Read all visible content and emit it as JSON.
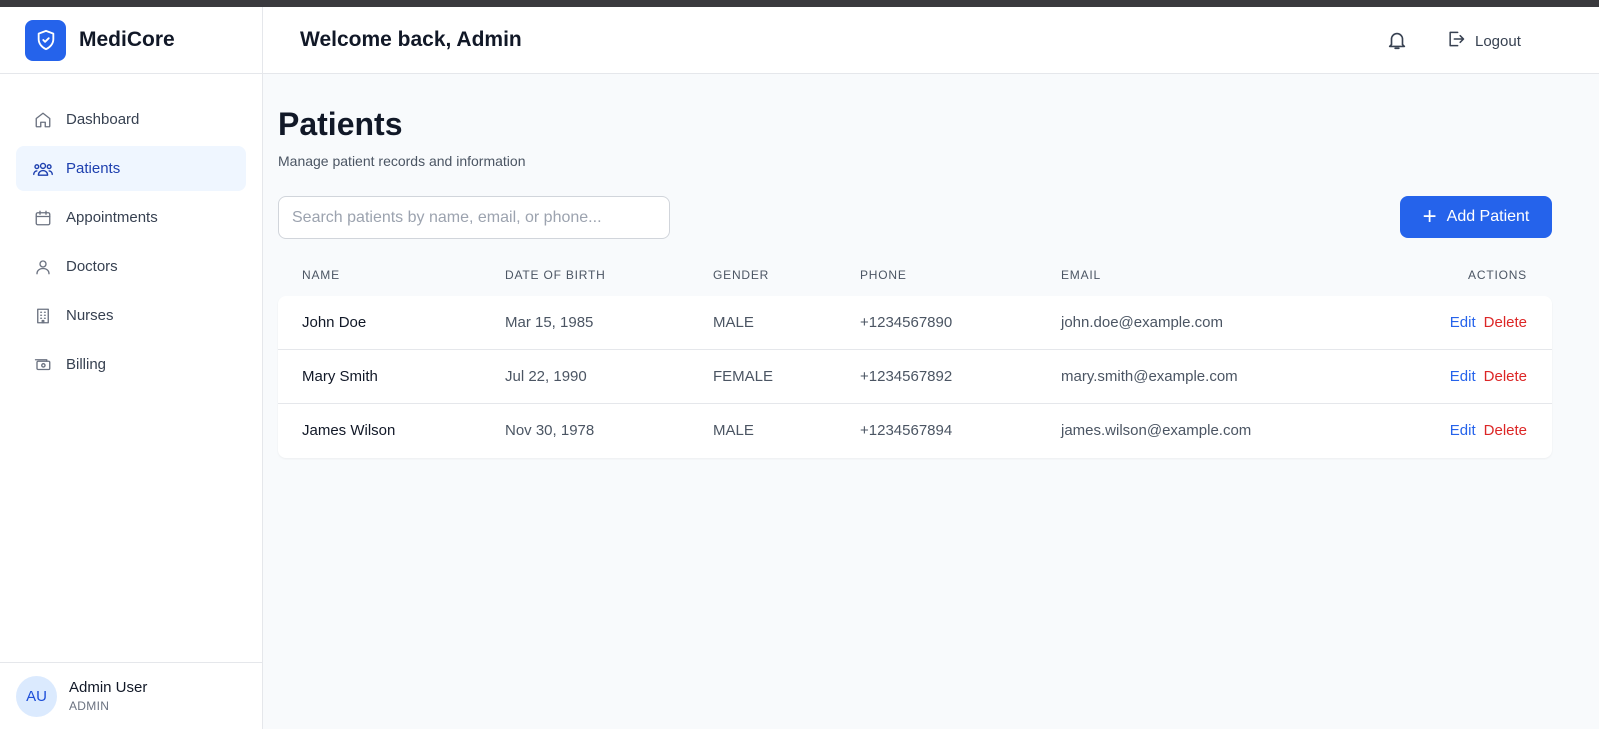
{
  "brand": {
    "name": "MediCore"
  },
  "sidebar": {
    "items": [
      {
        "label": "Dashboard",
        "icon": "home-icon",
        "active": false
      },
      {
        "label": "Patients",
        "icon": "users-icon",
        "active": true
      },
      {
        "label": "Appointments",
        "icon": "calendar-icon",
        "active": false
      },
      {
        "label": "Doctors",
        "icon": "user-icon",
        "active": false
      },
      {
        "label": "Nurses",
        "icon": "building-icon",
        "active": false
      },
      {
        "label": "Billing",
        "icon": "money-icon",
        "active": false
      }
    ],
    "user": {
      "initials": "AU",
      "name": "Admin User",
      "role": "ADMIN"
    }
  },
  "header": {
    "welcome": "Welcome back, Admin",
    "logout_label": "Logout"
  },
  "main": {
    "title": "Patients",
    "subtitle": "Manage patient records and information",
    "search_placeholder": "Search patients by name, email, or phone...",
    "add_button_label": "Add Patient"
  },
  "table": {
    "headers": {
      "name": "NAME",
      "dob": "DATE OF BIRTH",
      "gender": "GENDER",
      "phone": "PHONE",
      "email": "EMAIL",
      "actions": "ACTIONS"
    },
    "rows": [
      {
        "name": "John Doe",
        "dob": "Mar 15, 1985",
        "gender": "MALE",
        "phone": "+1234567890",
        "email": "john.doe@example.com",
        "edit": "Edit",
        "delete": "Delete"
      },
      {
        "name": "Mary Smith",
        "dob": "Jul 22, 1990",
        "gender": "FEMALE",
        "phone": "+1234567892",
        "email": "mary.smith@example.com",
        "edit": "Edit",
        "delete": "Delete"
      },
      {
        "name": "James Wilson",
        "dob": "Nov 30, 1978",
        "gender": "MALE",
        "phone": "+1234567894",
        "email": "james.wilson@example.com",
        "edit": "Edit",
        "delete": "Delete"
      }
    ]
  },
  "colors": {
    "accent": "#2563eb",
    "danger": "#dc2626",
    "active_bg": "#eff6ff"
  }
}
